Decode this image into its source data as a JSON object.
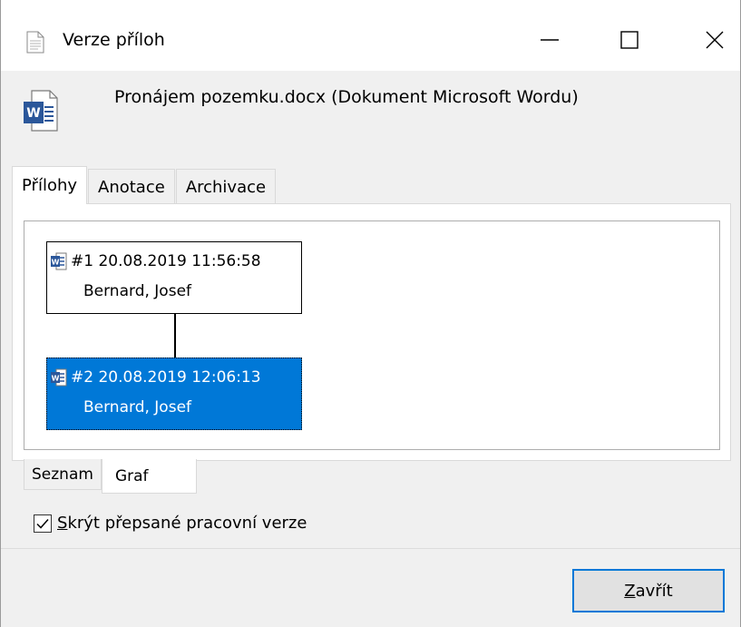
{
  "window": {
    "title": "Verze příloh",
    "controls": {
      "minimize": "minimize-icon",
      "maximize": "maximize-icon",
      "close": "close-icon"
    }
  },
  "header": {
    "file_title": "Pronájem pozemku.docx (Dokument Microsoft Wordu)",
    "icon": "word-document-icon"
  },
  "tabs_top": [
    {
      "label": "Přílohy",
      "active": true
    },
    {
      "label": "Anotace",
      "active": false
    },
    {
      "label": "Archivace",
      "active": false
    }
  ],
  "versions": [
    {
      "number": "#1",
      "datetime": "20.08.2019 11:56:58",
      "author": "Bernard, Josef",
      "selected": false
    },
    {
      "number": "#2",
      "datetime": "20.08.2019 12:06:13",
      "author": "Bernard, Josef",
      "selected": true
    }
  ],
  "tabs_bottom": [
    {
      "label": "Seznam",
      "active": false
    },
    {
      "label": "Graf",
      "active": true
    }
  ],
  "checkbox": {
    "mnemonic": "S",
    "rest": "krýt přepsané pracovní verze",
    "checked": true
  },
  "close_button": {
    "mnemonic": "Z",
    "rest": "avřít"
  },
  "colors": {
    "selection": "#0078d7",
    "focus_border": "#0078d7"
  }
}
